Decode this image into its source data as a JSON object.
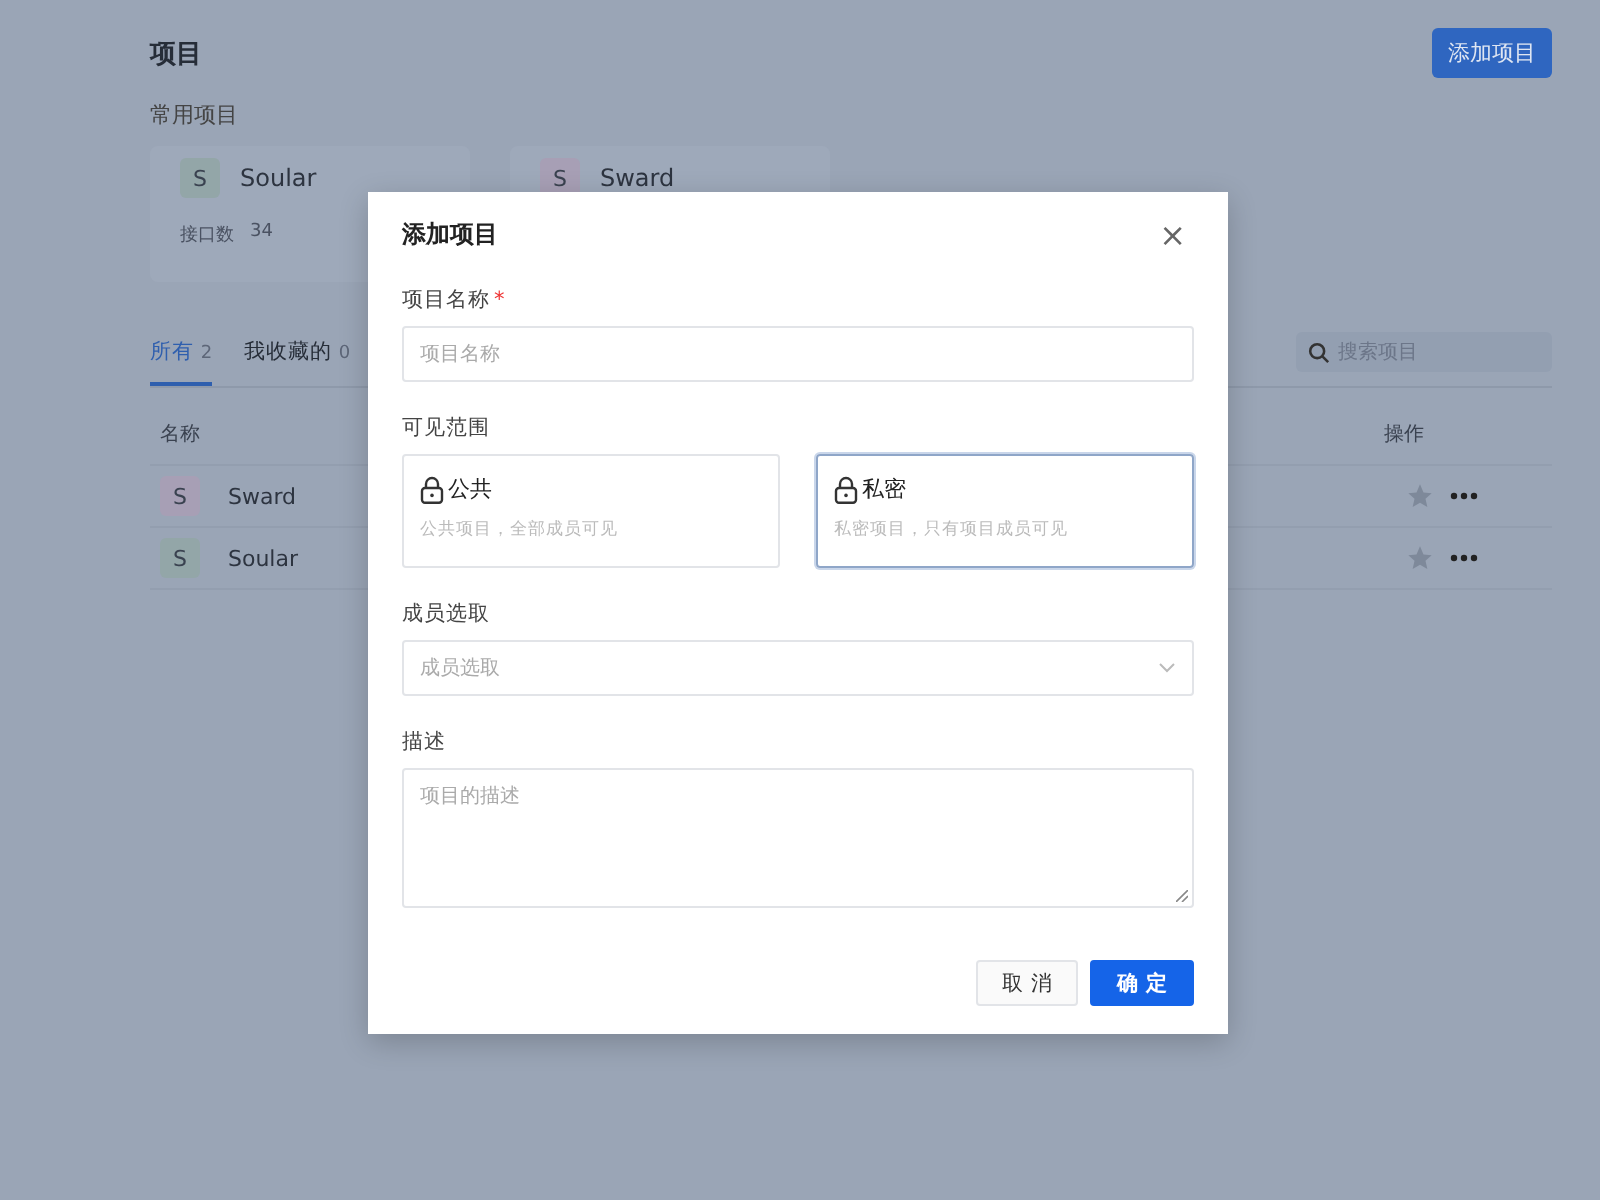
{
  "page": {
    "title": "项目",
    "add_button": "添加项目",
    "frequent_heading": "常用项目",
    "frequent": [
      {
        "avatar": "S",
        "name": "Soular",
        "stat_label": "接口数",
        "stat_value": "34",
        "color": "#93a6a8"
      },
      {
        "avatar": "S",
        "name": "Sward",
        "color": "#a79fb5"
      }
    ],
    "tabs": [
      {
        "label": "所有",
        "count": "2",
        "selected": true
      },
      {
        "label": "我收藏的",
        "count": "0",
        "selected": false
      }
    ],
    "search": {
      "placeholder": "搜索项目"
    },
    "table": {
      "columns": [
        "名称",
        "操作"
      ],
      "rows": [
        {
          "avatar": "S",
          "name": "Sward",
          "color": "#a79fb5",
          "starred": false
        },
        {
          "avatar": "S",
          "name": "Soular",
          "color": "#93a6a8",
          "starred": false
        }
      ]
    }
  },
  "dialog": {
    "title": "添加项目",
    "close": "×",
    "name_field": {
      "label": "项目名称",
      "required_mark": "*",
      "placeholder": "项目名称"
    },
    "visibility": {
      "label": "可见范围",
      "options": [
        {
          "title": "公共",
          "description": "公共项目，全部成员可见",
          "selected": false
        },
        {
          "title": "私密",
          "description": "私密项目，只有项目成员可见",
          "selected": true
        }
      ]
    },
    "members": {
      "label": "成员选取",
      "placeholder": "成员选取"
    },
    "description": {
      "label": "描述",
      "placeholder": "项目的描述"
    },
    "buttons": [
      {
        "label": "取 消",
        "kind": "secondary"
      },
      {
        "label": "确 定",
        "kind": "primary"
      }
    ]
  }
}
